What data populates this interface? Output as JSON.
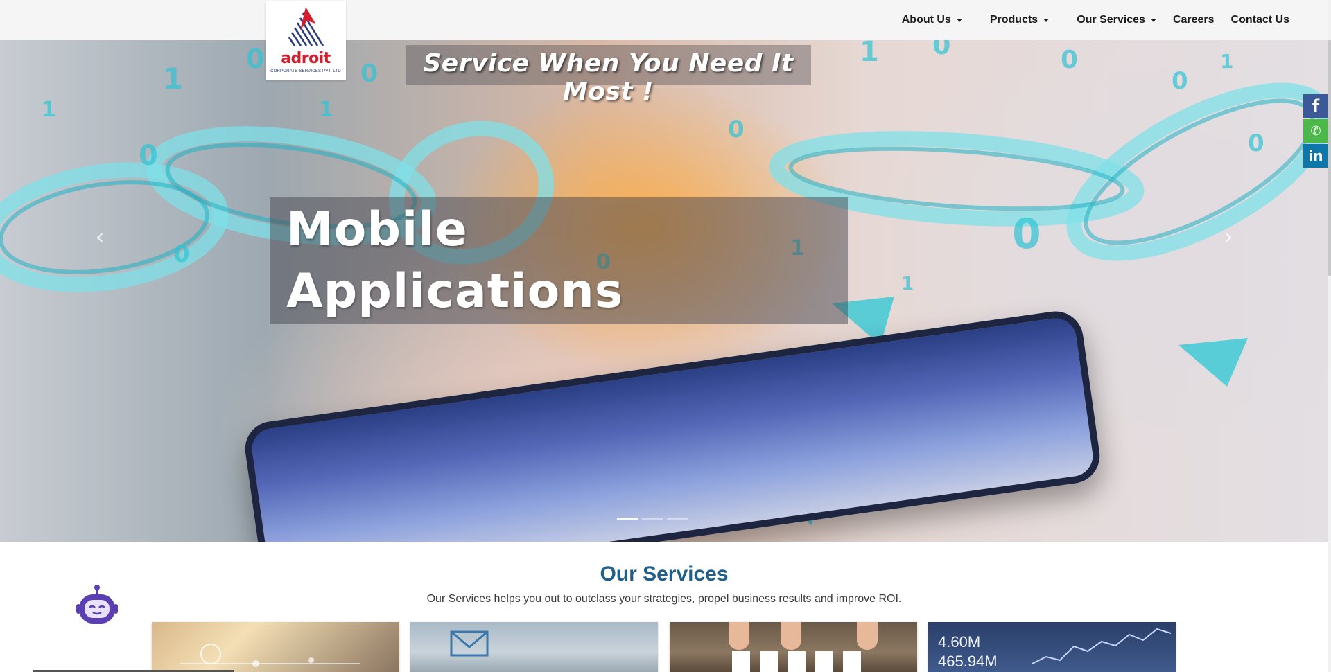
{
  "brand": {
    "logo_word": "adroit",
    "logo_sub": "CORPORATE SERVICES PVT. LTD",
    "colors": {
      "red": "#d21f2b",
      "navy": "#2b3a7a",
      "heading_blue": "#1f5f8b"
    }
  },
  "nav": {
    "items": [
      {
        "label": "About Us",
        "dropdown": true
      },
      {
        "label": "Products",
        "dropdown": true
      },
      {
        "label": "Our Services",
        "dropdown": true
      },
      {
        "label": "Careers",
        "dropdown": false
      },
      {
        "label": "Contact Us",
        "dropdown": false
      }
    ]
  },
  "hero": {
    "tagline": "Service When You Need It Most !",
    "caption_line1": "Mobile",
    "caption_line2": "Applications",
    "prev_icon": "chevron-left-icon",
    "next_icon": "chevron-right-icon",
    "prev_glyph": "‹",
    "next_glyph": "›",
    "slide_count": 3,
    "active_slide": 1
  },
  "social": {
    "facebook_glyph": "f",
    "phone_glyph": "✆",
    "linkedin_glyph": "in"
  },
  "services": {
    "title": "Our Services",
    "subtitle": "Our Services helps you out to outclass your strategies, propel business results and improve ROI.",
    "card4_values": [
      "4.60M",
      "465.94M"
    ]
  }
}
